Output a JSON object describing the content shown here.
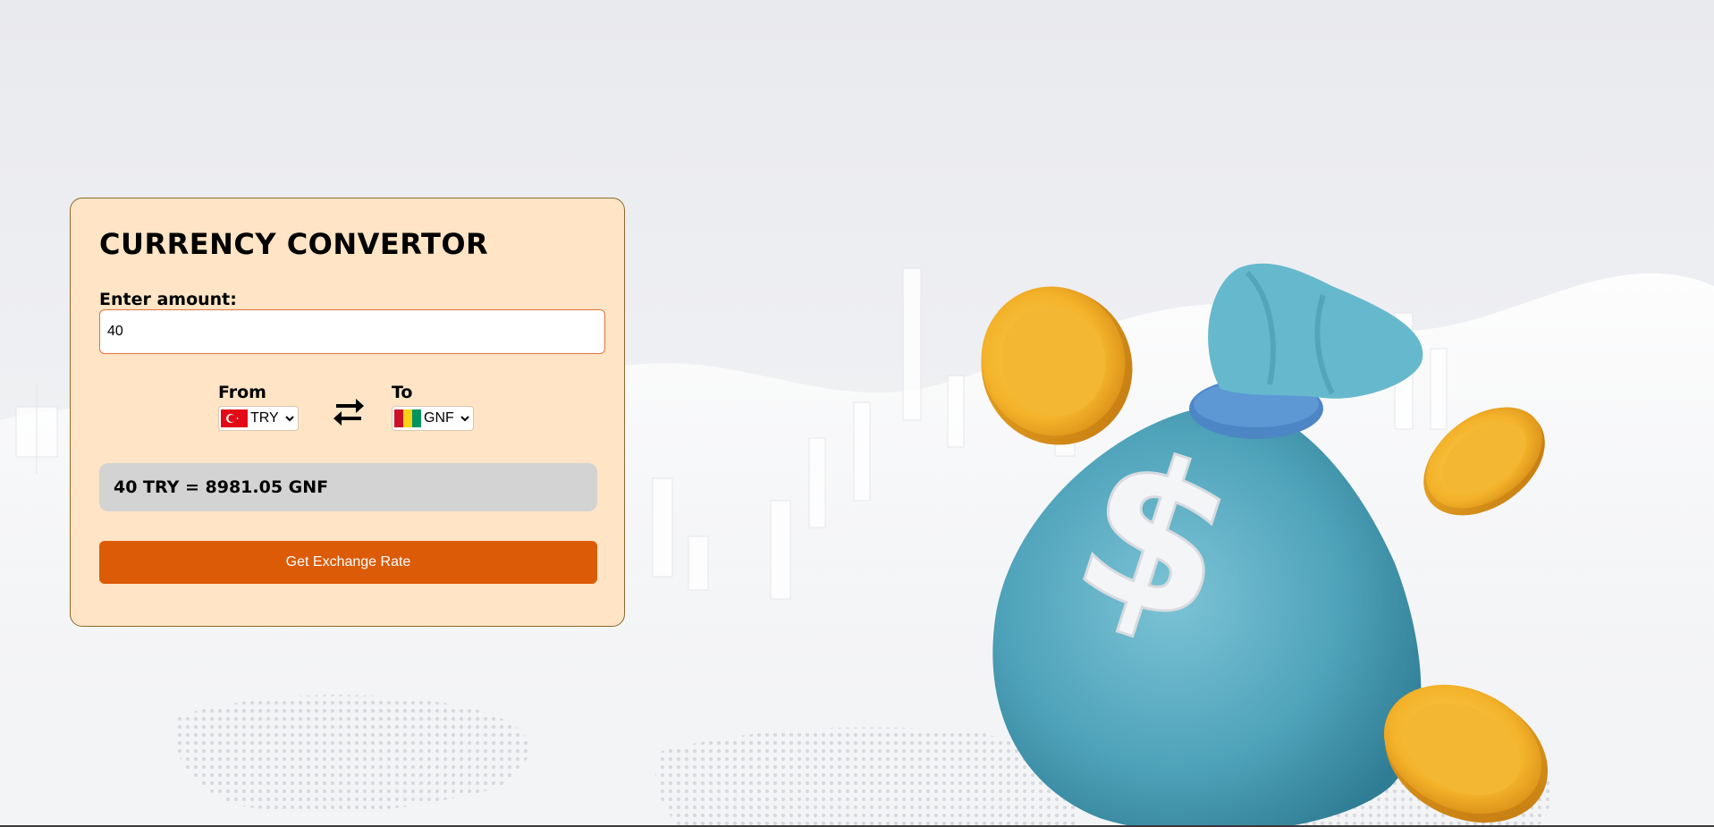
{
  "converter": {
    "title": "CURRENCY CONVERTOR",
    "amount_label": "Enter amount:",
    "amount_value": "40",
    "from": {
      "label": "From",
      "selected": "TRY",
      "flag_icon": "turkey-flag-icon"
    },
    "to": {
      "label": "To",
      "selected": "GNF",
      "flag_icon": "guinea-flag-icon"
    },
    "swap_icon": "swap-arrows-icon",
    "result_text": "40 TRY = 8981.05 GNF",
    "button_label": "Get Exchange Rate"
  },
  "colors": {
    "card_background": "#ffe4c5",
    "card_border": "#8a6a2a",
    "input_border": "#e2703b",
    "result_background": "#d3d3d3",
    "button_background": "#db5b06",
    "button_text": "#ffffff",
    "page_background": "#eceef1"
  },
  "illustration": {
    "icon": "money-bag-with-coins-icon",
    "background": "stock-chart-and-world-map-backdrop"
  }
}
